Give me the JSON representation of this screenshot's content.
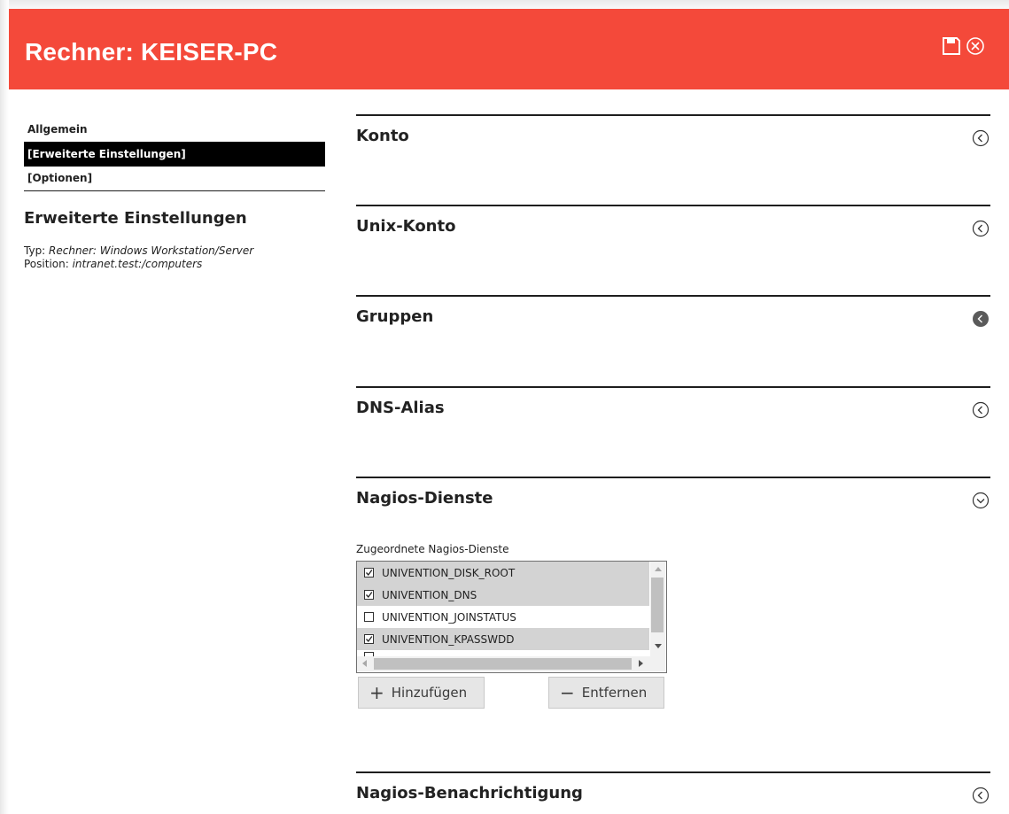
{
  "header": {
    "title": "Rechner: KEISER-PC",
    "icons": [
      "save-icon",
      "close-circle-icon"
    ],
    "background": "#f4493a"
  },
  "nav": {
    "items": [
      {
        "label": "Allgemein",
        "active": false
      },
      {
        "label": "[Erweiterte Einstellungen]",
        "active": true
      },
      {
        "label": "[Optionen]",
        "active": false
      }
    ]
  },
  "page": {
    "title": "Erweiterte Einstellungen",
    "type_label": "Typ: ",
    "type_value": "Rechner: Windows Workstation/Server",
    "position_label": "Position: ",
    "position_value": "intranet.test:/computers"
  },
  "sections": [
    {
      "title": "Konto",
      "state": "collapsed"
    },
    {
      "title": "Unix-Konto",
      "state": "collapsed"
    },
    {
      "title": "Gruppen",
      "state": "collapsed-hover"
    },
    {
      "title": "DNS-Alias",
      "state": "collapsed"
    },
    {
      "title": "Nagios-Dienste",
      "state": "expanded"
    },
    {
      "title": "Nagios-Benachrichtigung",
      "state": "collapsed"
    }
  ],
  "nagios": {
    "field_label": "Zugeordnete Nagios-Dienste",
    "services": [
      {
        "name": "UNIVENTION_DISK_ROOT",
        "checked": true
      },
      {
        "name": "UNIVENTION_DNS",
        "checked": true
      },
      {
        "name": "UNIVENTION_JOINSTATUS",
        "checked": false
      },
      {
        "name": "UNIVENTION_KPASSWDD",
        "checked": true
      }
    ],
    "add_button": "Hinzufügen",
    "remove_button": "Entfernen"
  }
}
